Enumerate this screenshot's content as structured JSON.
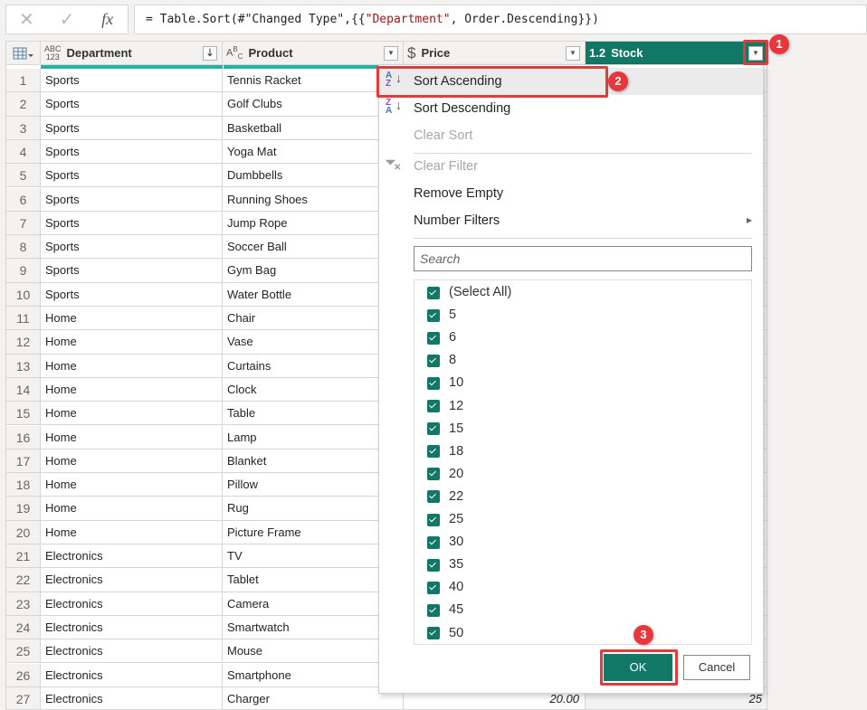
{
  "formula_bar": {
    "cancel_icon": "x-icon",
    "confirm_icon": "check-icon",
    "fx_label": "fx",
    "formula_prefix": "= Table.Sort(#\"Changed Type\",{{",
    "formula_string": "\"Department\"",
    "formula_suffix": ", Order.Descending}})"
  },
  "grid": {
    "columns": [
      {
        "name": "Department",
        "type_label_top": "ABC",
        "type_label_bottom": "123",
        "dropdown_icon": "sort-descending-icon"
      },
      {
        "name": "Product",
        "type_label_top": "ABC",
        "dropdown_icon": "chevron-down-icon"
      },
      {
        "name": "Price",
        "type_label_top": "$",
        "dropdown_icon": "chevron-down-icon"
      },
      {
        "name": "Stock",
        "type_label_top": "1.2",
        "dropdown_icon": "chevron-down-icon",
        "selected": true
      }
    ],
    "rows": [
      {
        "n": "1",
        "dept": "Sports",
        "product": "Tennis Racket"
      },
      {
        "n": "2",
        "dept": "Sports",
        "product": "Golf Clubs"
      },
      {
        "n": "3",
        "dept": "Sports",
        "product": "Basketball"
      },
      {
        "n": "4",
        "dept": "Sports",
        "product": "Yoga Mat"
      },
      {
        "n": "5",
        "dept": "Sports",
        "product": "Dumbbells"
      },
      {
        "n": "6",
        "dept": "Sports",
        "product": "Running Shoes"
      },
      {
        "n": "7",
        "dept": "Sports",
        "product": "Jump Rope"
      },
      {
        "n": "8",
        "dept": "Sports",
        "product": "Soccer Ball"
      },
      {
        "n": "9",
        "dept": "Sports",
        "product": "Gym Bag"
      },
      {
        "n": "10",
        "dept": "Sports",
        "product": "Water Bottle"
      },
      {
        "n": "11",
        "dept": "Home",
        "product": "Chair"
      },
      {
        "n": "12",
        "dept": "Home",
        "product": "Vase"
      },
      {
        "n": "13",
        "dept": "Home",
        "product": "Curtains"
      },
      {
        "n": "14",
        "dept": "Home",
        "product": "Clock"
      },
      {
        "n": "15",
        "dept": "Home",
        "product": "Table"
      },
      {
        "n": "16",
        "dept": "Home",
        "product": "Lamp"
      },
      {
        "n": "17",
        "dept": "Home",
        "product": "Blanket"
      },
      {
        "n": "18",
        "dept": "Home",
        "product": "Pillow"
      },
      {
        "n": "19",
        "dept": "Home",
        "product": "Rug"
      },
      {
        "n": "20",
        "dept": "Home",
        "product": "Picture Frame"
      },
      {
        "n": "21",
        "dept": "Electronics",
        "product": "TV"
      },
      {
        "n": "22",
        "dept": "Electronics",
        "product": "Tablet"
      },
      {
        "n": "23",
        "dept": "Electronics",
        "product": "Camera"
      },
      {
        "n": "24",
        "dept": "Electronics",
        "product": "Smartwatch"
      },
      {
        "n": "25",
        "dept": "Electronics",
        "product": "Mouse"
      },
      {
        "n": "26",
        "dept": "Electronics",
        "product": "Smartphone"
      },
      {
        "n": "27",
        "dept": "Electronics",
        "product": "Charger",
        "price": "20.00",
        "stock": "25"
      }
    ]
  },
  "filter_menu": {
    "items": [
      {
        "label": "Sort Ascending",
        "icon": "sort-ascending-icon",
        "highlighted": true
      },
      {
        "label": "Sort Descending",
        "icon": "sort-descending-icon"
      },
      {
        "label": "Clear Sort",
        "disabled": true
      },
      {
        "label": "Clear Filter",
        "icon": "clear-filter-icon",
        "disabled": true
      },
      {
        "label": "Remove Empty"
      },
      {
        "label": "Number Filters",
        "submenu": true
      }
    ],
    "search_placeholder": "Search",
    "values": [
      "(Select All)",
      "5",
      "6",
      "8",
      "10",
      "12",
      "15",
      "18",
      "20",
      "22",
      "25",
      "30",
      "35",
      "40",
      "45",
      "50"
    ],
    "all_checked": true,
    "ok_label": "OK",
    "cancel_label": "Cancel"
  },
  "annotations": [
    {
      "label": "1",
      "target": "stock-dropdown"
    },
    {
      "label": "2",
      "target": "sort-ascending"
    },
    {
      "label": "3",
      "target": "ok-button"
    }
  ],
  "colors": {
    "accent": "#117865",
    "column_quality_bar": "#1fb5a3",
    "callout": "#e03c3c"
  }
}
